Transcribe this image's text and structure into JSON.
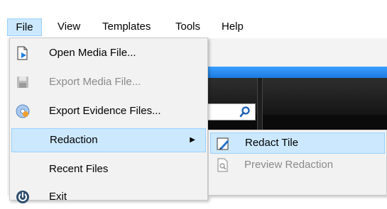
{
  "menubar": {
    "items": [
      {
        "label": "File"
      },
      {
        "label": "View"
      },
      {
        "label": "Templates"
      },
      {
        "label": "Tools"
      },
      {
        "label": "Help"
      }
    ]
  },
  "file_menu": {
    "items": [
      {
        "label": "Open Media File...",
        "icon": "open-file-icon",
        "enabled": true
      },
      {
        "label": "Export Media File...",
        "icon": "save-disk-icon",
        "enabled": false
      },
      {
        "label": "Export Evidence Files...",
        "icon": "export-disc-icon",
        "enabled": true
      },
      {
        "label": "Redaction",
        "icon": null,
        "enabled": true,
        "highlighted": true,
        "submenu": true
      },
      {
        "label": "Recent Files",
        "icon": null,
        "enabled": true
      },
      {
        "label": "Exit",
        "icon": "power-icon",
        "enabled": true
      }
    ]
  },
  "redaction_submenu": {
    "items": [
      {
        "label": "Redact Tile",
        "icon": "redact-tile-icon",
        "enabled": true,
        "highlighted": true
      },
      {
        "label": "Preview Redaction",
        "icon": "preview-document-icon",
        "enabled": false
      }
    ]
  },
  "colors": {
    "highlight": "#cce8ff",
    "highlight_border": "#99d1ff",
    "accent_blue": "#1a7ae0"
  }
}
